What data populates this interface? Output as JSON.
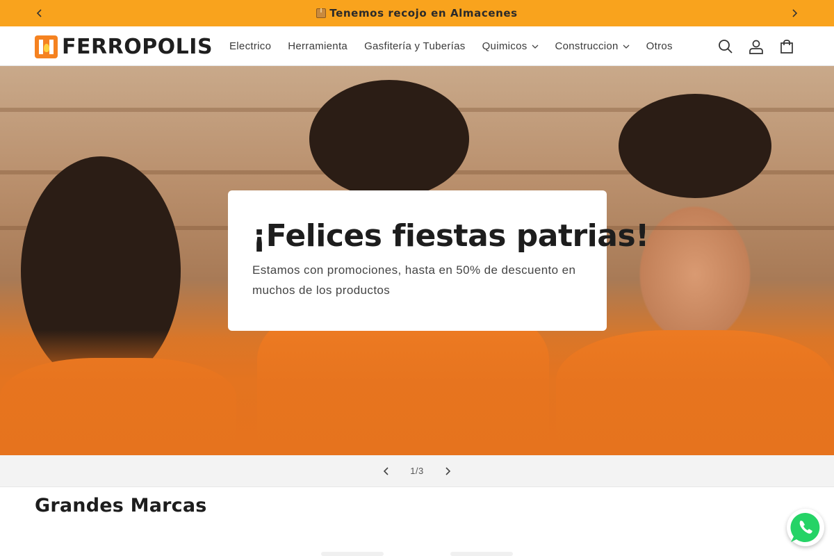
{
  "announcement": {
    "text": "Tenemos recojo en Almacenes",
    "icon": "package-icon",
    "background": "#f9a31d"
  },
  "header": {
    "logo_text": "FERROPOLIS",
    "nav": [
      {
        "label": "Electrico",
        "dropdown": false
      },
      {
        "label": "Herramienta",
        "dropdown": false
      },
      {
        "label": "Gasfitería y Tuberías",
        "dropdown": false
      },
      {
        "label": "Quimicos",
        "dropdown": true
      },
      {
        "label": "Construccion",
        "dropdown": true
      },
      {
        "label": "Otros",
        "dropdown": false
      }
    ],
    "icons": [
      "search-icon",
      "account-icon",
      "cart-icon"
    ]
  },
  "hero": {
    "title": "¡Felices fiestas patrias!",
    "subtitle": "Estamos con promociones, hasta en 50% de descuento en muchos de los productos"
  },
  "slider": {
    "counter": "1/3"
  },
  "section": {
    "title": "Grandes Marcas"
  },
  "colors": {
    "accent": "#f9a31d",
    "brand_orange": "#f58220",
    "whatsapp": "#25d366"
  }
}
